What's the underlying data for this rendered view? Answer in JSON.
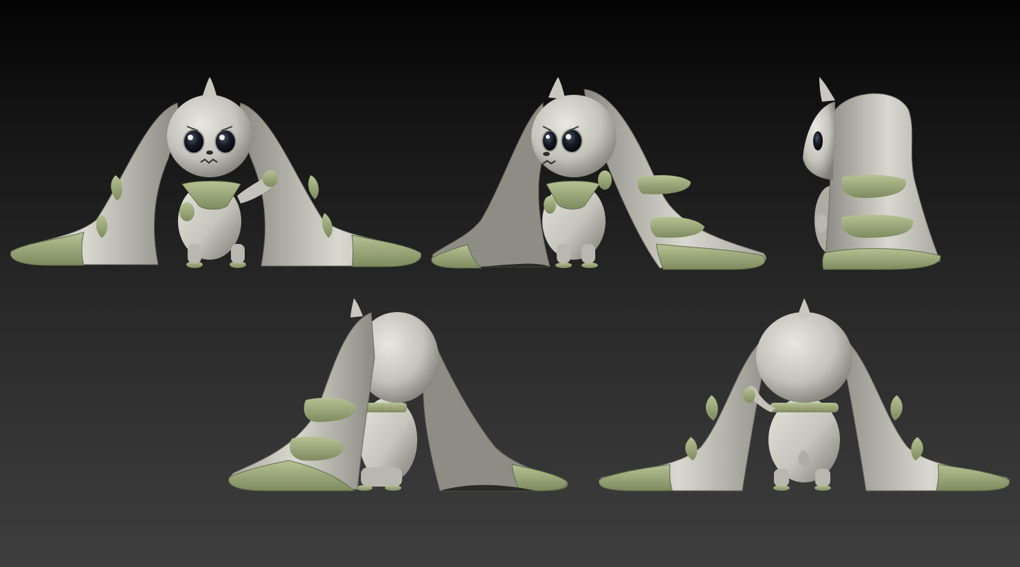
{
  "viewport": {
    "background_top": "#030303",
    "background_bottom": "#3e3e3e"
  },
  "model": {
    "body_color": "#c8c7bf",
    "body_shadow": "#7d7c74",
    "accent_color": "#a8b585",
    "accent_shadow": "#6e7a55",
    "eye_color": "#141a24",
    "highlight": "#f0f0ea"
  },
  "views": [
    {
      "angle": "front"
    },
    {
      "angle": "three-quarter-left"
    },
    {
      "angle": "side"
    },
    {
      "angle": "three-quarter-back"
    },
    {
      "angle": "back"
    }
  ]
}
